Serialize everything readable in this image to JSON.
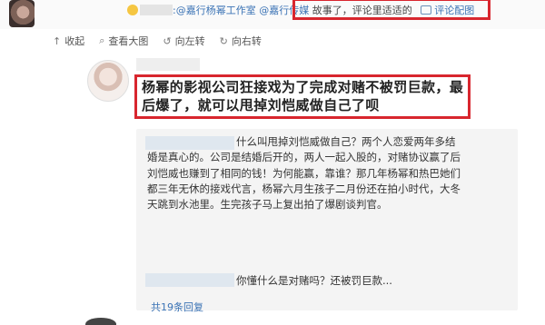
{
  "top_bar": {
    "mention_1": "@嘉行杨幂工作室",
    "mention_2": "@嘉行传媒",
    "suffix": "故事了，评论里适适的",
    "pic_label": "评论配图"
  },
  "toolbar": {
    "collapse": "收起",
    "view_large": "查看大图",
    "rotate_left": "向左转",
    "rotate_right": "向右转"
  },
  "comment": {
    "text": "杨幂的影视公司狂接戏为了完成对赌不被罚巨款，最后爆了，就可以甩掉刘恺威做自己了呗"
  },
  "reply_1": {
    "text": "什么叫甩掉刘恺威做自己？两个人恋爱两年多结婚是真心的。公司是结婚后开的，两人一起入股的，对赌协议赢了后刘恺威也赚到了相同的钱！为何能赢，靠谁？那几年杨幂和热巴她们都三年无休的接戏代言，杨幂六月生孩子二月份还在拍小时代，大冬天跳到水池里。生完孩子马上复出拍了爆剧谈判官。"
  },
  "reply_2": {
    "text": "你懂什么是对赌吗？还被罚巨款..."
  },
  "more_replies": "共19条回复"
}
